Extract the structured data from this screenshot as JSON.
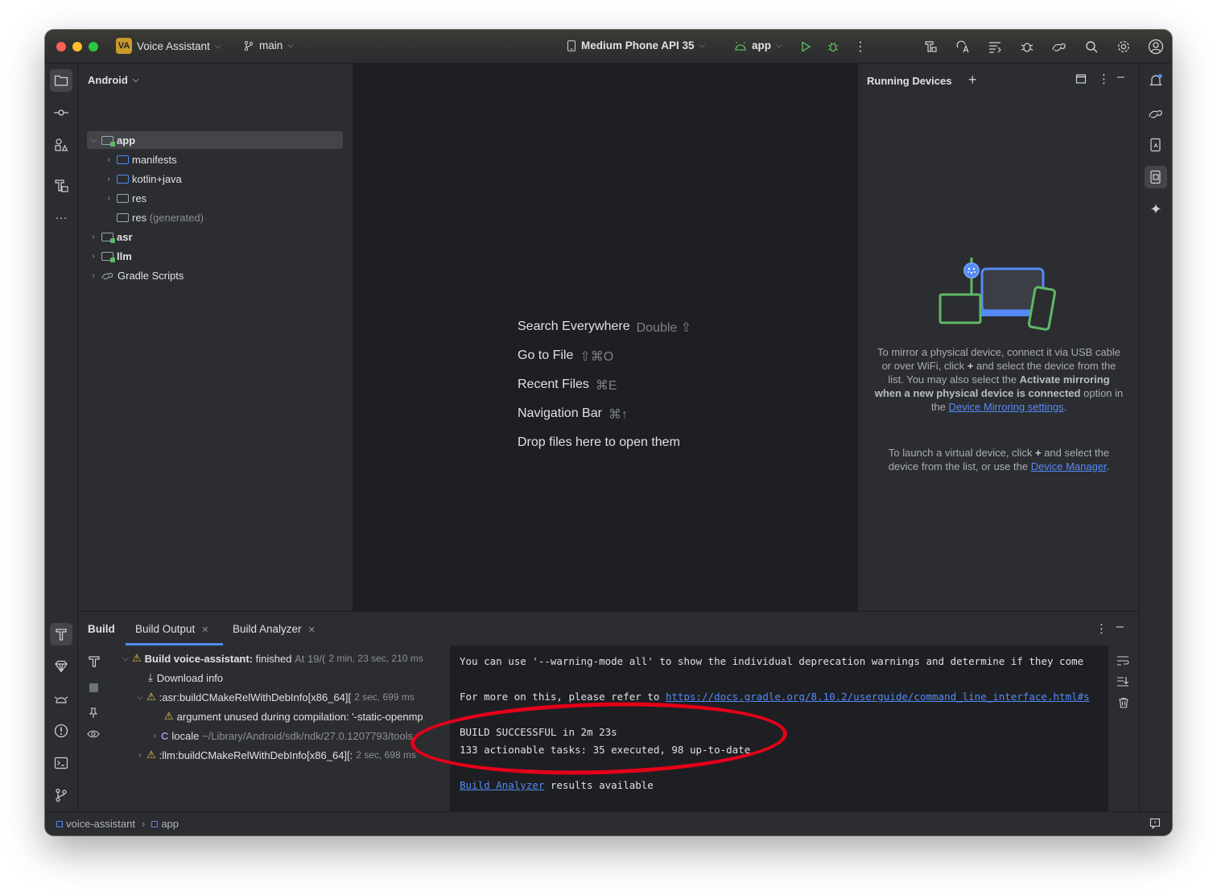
{
  "titlebar": {
    "project_badge": "VA",
    "project_name": "Voice Assistant",
    "branch": "main",
    "device": "Medium Phone API 35",
    "run_config": "app"
  },
  "project_panel": {
    "view_mode": "Android",
    "tree": [
      {
        "label": "app",
        "suffix": ""
      },
      {
        "label": "manifests",
        "suffix": ""
      },
      {
        "label": "kotlin+java",
        "suffix": ""
      },
      {
        "label": "res",
        "suffix": ""
      },
      {
        "label": "res",
        "suffix": "(generated)"
      },
      {
        "label": "asr",
        "suffix": ""
      },
      {
        "label": "llm",
        "suffix": ""
      },
      {
        "label": "Gradle Scripts",
        "suffix": ""
      }
    ]
  },
  "editor": {
    "hints": [
      {
        "label": "Search Everywhere",
        "key": "Double ⇧"
      },
      {
        "label": "Go to File",
        "key": "⇧⌘O"
      },
      {
        "label": "Recent Files",
        "key": "⌘E"
      },
      {
        "label": "Navigation Bar",
        "key": "⌘↑"
      },
      {
        "label": "Drop files here to open them",
        "key": ""
      }
    ]
  },
  "running_devices": {
    "title": "Running Devices",
    "mirror_text_1": "To mirror a physical device, connect it via USB cable or over WiFi, click",
    "mirror_text_2": "and select the device from the list. You may also select the",
    "mirror_bold": "Activate mirroring when a new physical device is connected",
    "mirror_text_3": "option in the",
    "mirror_link": "Device Mirroring settings",
    "virtual_text_1": "To launch a virtual device, click",
    "virtual_text_2": "and select the device from the list, or use the",
    "virtual_link": "Device Manager"
  },
  "build": {
    "tabs": [
      {
        "label": "Build"
      },
      {
        "label": "Build Output"
      },
      {
        "label": "Build Analyzer"
      }
    ],
    "tree": [
      {
        "label": "Build voice-assistant:",
        "bold_suffix": "finished",
        "meta": "At 19/(",
        "time": "2 min, 23 sec, 210 ms"
      },
      {
        "label": "Download info",
        "meta": "",
        "time": ""
      },
      {
        "label": ":asr:buildCMakeRelWithDebInfo[x86_64][",
        "meta": "",
        "time": "2 sec, 699 ms"
      },
      {
        "label": "argument unused during compilation: '-static-openmp",
        "meta": "",
        "time": ""
      },
      {
        "label": "locale",
        "meta": "~/Library/Android/sdk/ndk/27.0.120779",
        "time": "3/tools"
      },
      {
        "label": ":llm:buildCMakeRelWithDebInfo[x86_64][:",
        "meta": "",
        "time": "2 sec, 698 ms"
      }
    ],
    "console": {
      "line1": "You can use '--warning-mode all' to show the individual deprecation warnings and determine if they come",
      "line2_prefix": "For more on this, please refer to ",
      "line2_link": "https://docs.gradle.org/8.10.2/userguide/command_line_interface.html#s",
      "line3": "BUILD SUCCESSFUL in 2m 23s",
      "line4": "133 actionable tasks: 35 executed, 98 up-to-date",
      "line5_link": "Build Analyzer",
      "line5_suffix": " results available"
    }
  },
  "statusbar": {
    "crumbs": [
      "voice-assistant",
      "app"
    ]
  },
  "colors": {
    "annotation": "#e5001a",
    "accent": "#548af7",
    "warning": "#f2c55c"
  }
}
